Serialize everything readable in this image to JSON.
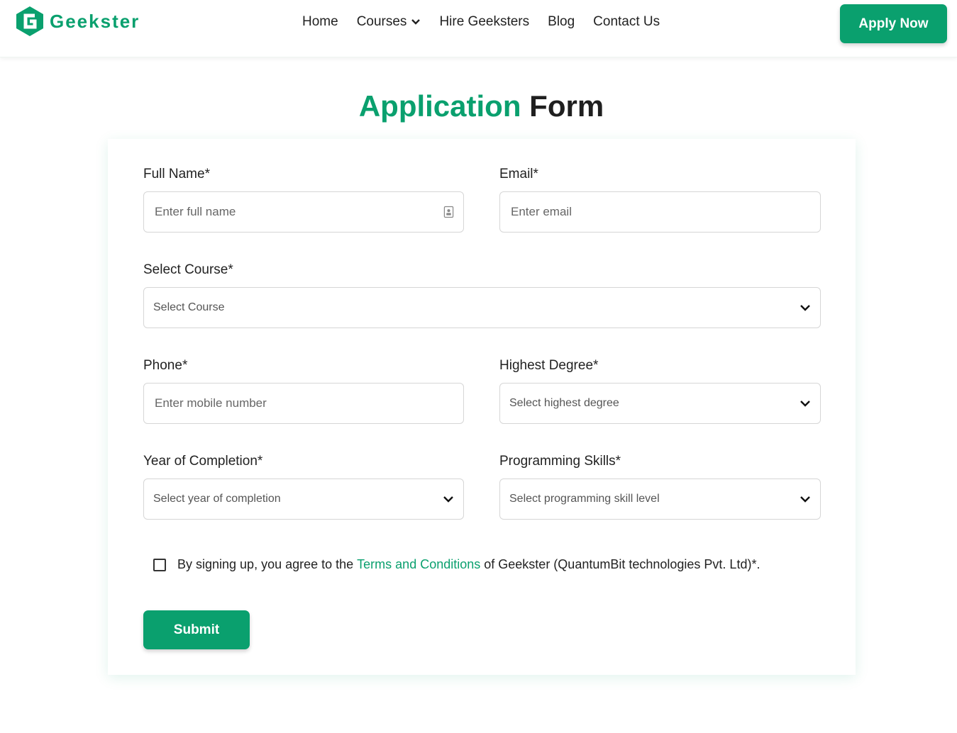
{
  "header": {
    "logo_text": "Geekster",
    "nav": [
      {
        "label": "Home"
      },
      {
        "label": "Courses"
      },
      {
        "label": "Hire Geeksters"
      },
      {
        "label": "Blog"
      },
      {
        "label": "Contact Us"
      }
    ],
    "apply_label": "Apply Now"
  },
  "title": {
    "accent": "Application",
    "rest": "Form"
  },
  "form": {
    "full_name": {
      "label": "Full Name*",
      "placeholder": "Enter full name"
    },
    "email": {
      "label": "Email*",
      "placeholder": "Enter email"
    },
    "course": {
      "label": "Select Course*",
      "placeholder": "Select Course"
    },
    "phone": {
      "label": "Phone*",
      "placeholder": "Enter mobile number"
    },
    "degree": {
      "label": "Highest Degree*",
      "placeholder": "Select highest degree"
    },
    "year": {
      "label": "Year of Completion*",
      "placeholder": "Select year of completion"
    },
    "skills": {
      "label": "Programming Skills*",
      "placeholder": "Select programming skill level"
    },
    "consent": {
      "before": "By signing up, you agree to the",
      "link": "Terms and Conditions",
      "after": "of Geekster (QuantumBit technologies Pvt. Ltd)*."
    },
    "submit_label": "Submit"
  },
  "colors": {
    "accent": "#0aa06e"
  }
}
